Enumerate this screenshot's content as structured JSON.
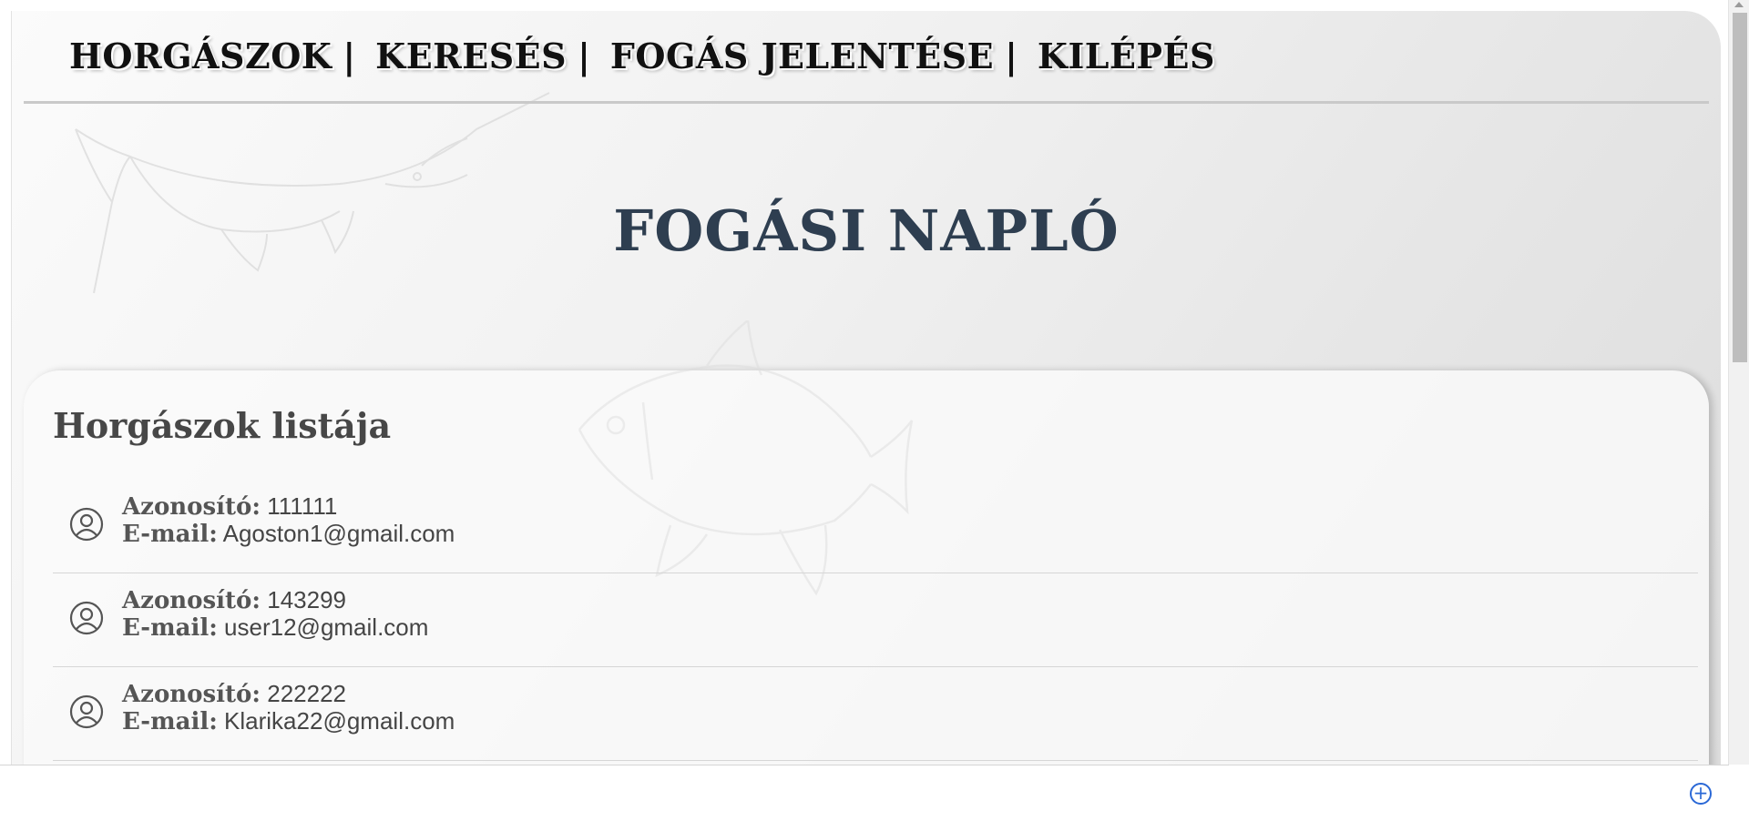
{
  "nav": {
    "items": [
      {
        "label": "HORGÁSZOK"
      },
      {
        "label": "KERESÉS"
      },
      {
        "label": "FOGÁS JELENTÉSE"
      },
      {
        "label": "KILÉPÉS"
      }
    ],
    "separator": "|"
  },
  "page": {
    "title": "FOGÁSI NAPLÓ"
  },
  "anglers": {
    "heading": "Horgászok listája",
    "id_label": "Azonosító:",
    "email_label": "E-mail:",
    "items": [
      {
        "id": "111111",
        "email": "Agoston1@gmail.com",
        "icon": "user-circle-icon"
      },
      {
        "id": "143299",
        "email": "user12@gmail.com",
        "icon": "user-circle-icon"
      },
      {
        "id": "222222",
        "email": "Klarika22@gmail.com",
        "icon": "user-circle-icon"
      }
    ]
  },
  "footer": {
    "add_icon": "plus-circle-icon"
  },
  "colors": {
    "title": "#2e3e50",
    "accent": "#2a68d6"
  }
}
